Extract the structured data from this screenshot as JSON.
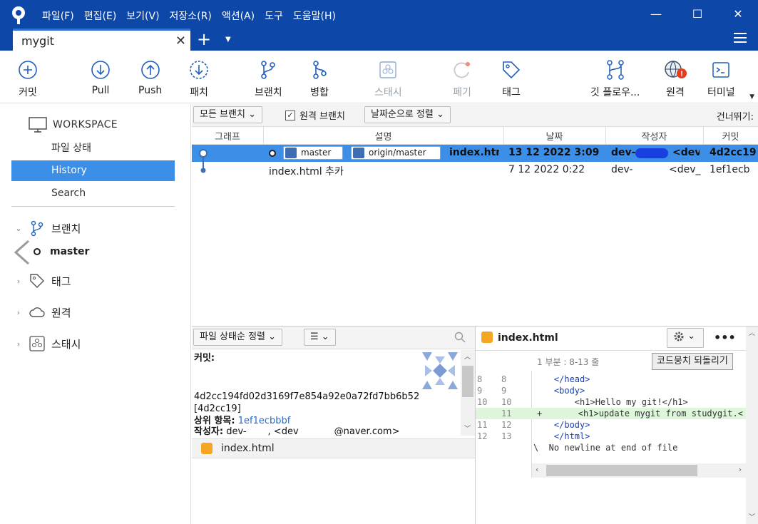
{
  "app": {
    "menu": [
      "파일(F)",
      "편집(E)",
      "보기(V)",
      "저장소(R)",
      "액션(A)",
      "도구",
      "도움말(H)"
    ],
    "window_controls": {
      "minimize": "—",
      "maximize": "☐",
      "close": "✕"
    }
  },
  "tabs": {
    "active_title": "mygit",
    "close_glyph": "✕",
    "add_glyph": "+",
    "dropdown_glyph": "▼"
  },
  "toolbar": {
    "commit": "커밋",
    "pull": "Pull",
    "push": "Push",
    "fetch": "패치",
    "branch": "브랜치",
    "merge": "병합",
    "stash": "스태시",
    "discard": "폐기",
    "tag": "태그",
    "git_flow": "깃 플로우...",
    "remote": "원격",
    "terminal": "터미널",
    "remote_badge": "!"
  },
  "sidebar": {
    "workspace": "WORKSPACE",
    "items": [
      "파일 상태",
      "History",
      "Search"
    ],
    "active_item": "History",
    "branches_label": "브랜치",
    "current_branch": "master",
    "tags_label": "태그",
    "remotes_label": "원격",
    "stashes_label": "스태시"
  },
  "log": {
    "branch_filter": "모든 브랜치",
    "remote_branch_checkbox": "원격 브랜치",
    "remote_branch_checked": true,
    "sort": "날짜순으로 정렬",
    "skip_label": "건너뛰기:",
    "columns": [
      "그래프",
      "설명",
      "날짜",
      "작성자",
      "커밋"
    ],
    "rows": [
      {
        "refs": [
          "master",
          "origin/master"
        ],
        "description": "index.htm",
        "date": "13 12 2022 3:09",
        "author": "dev-",
        "email": "<dev_",
        "commit": "4d2cc19"
      },
      {
        "refs": [],
        "description": "index.html 추카",
        "date": "7 12 2022 0:22",
        "author": "dev-",
        "email": "<dev_y",
        "commit": "1ef1ecb"
      }
    ]
  },
  "files_panel": {
    "sort": "파일 상태순 정렬",
    "view_toggle": "☰",
    "commit_label": "커밋:",
    "commit_hash": "4d2cc194fd02d3169f7e854a92e0a72fd7bb6b52",
    "commit_short": "[4d2cc19]",
    "parent_label": "상위 항목:",
    "parent_value": "1ef1ecbbbf",
    "author_label": "작성자:",
    "author_value": "dev-",
    "author_email_start": ", <dev",
    "author_email_end": "@naver.com>",
    "file": "index.html"
  },
  "diff_panel": {
    "file": "index.html",
    "hunk": "1 부분 : 8-13 줄",
    "revert_button": "코드뭉치 되돌리기",
    "more": "•••",
    "lines": [
      {
        "old": "8",
        "new": "8",
        "text": "    </head>",
        "type": "ctx"
      },
      {
        "old": "9",
        "new": "9",
        "text": "    <body>",
        "type": "ctx"
      },
      {
        "old": "10",
        "new": "10",
        "text": "        <h1>Hello my git!</h1>",
        "type": "ctx"
      },
      {
        "old": "",
        "new": "11",
        "text": "+       <h1>update mygit from studygit.<",
        "type": "add"
      },
      {
        "old": "11",
        "new": "12",
        "text": "    </body>",
        "type": "ctx"
      },
      {
        "old": "12",
        "new": "13",
        "text": "    </html>",
        "type": "ctx"
      },
      {
        "old": "",
        "new": "",
        "text": "\\  No newline at end of file",
        "type": "ctx"
      }
    ]
  }
}
